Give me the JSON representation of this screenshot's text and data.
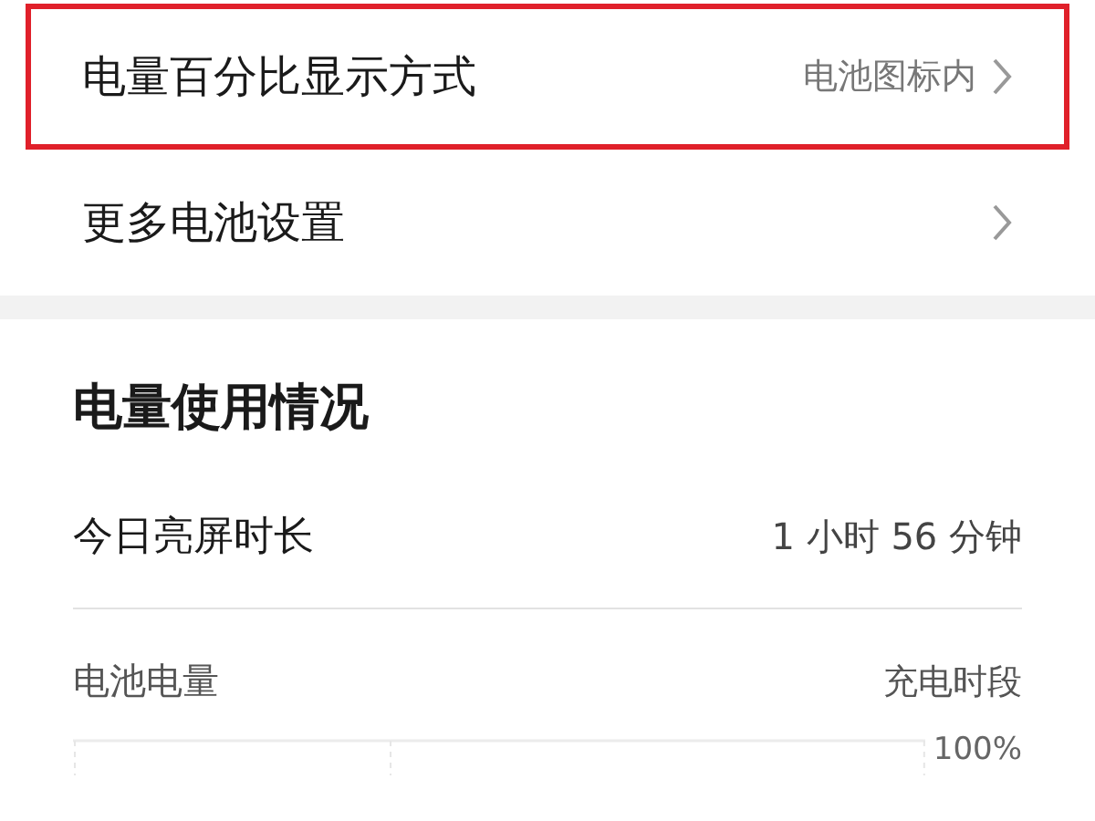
{
  "settings": [
    {
      "label": "电量百分比显示方式",
      "value": "电池图标内",
      "highlighted": true
    },
    {
      "label": "更多电池设置",
      "highlighted": false
    }
  ],
  "usage": {
    "title": "电量使用情况",
    "screen_time": {
      "label": "今日亮屏时长",
      "value": "1 小时 56 分钟"
    },
    "battery": {
      "label": "电池电量",
      "legend": "充电时段",
      "axis_label": "100%"
    }
  }
}
